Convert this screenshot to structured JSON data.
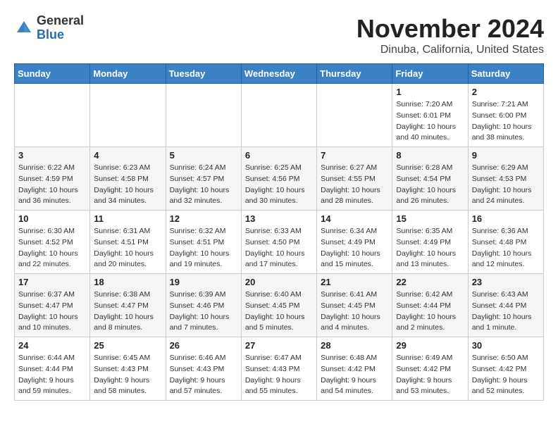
{
  "logo": {
    "general": "General",
    "blue": "Blue"
  },
  "header": {
    "month_year": "November 2024",
    "location": "Dinuba, California, United States"
  },
  "weekdays": [
    "Sunday",
    "Monday",
    "Tuesday",
    "Wednesday",
    "Thursday",
    "Friday",
    "Saturday"
  ],
  "weeks": [
    [
      {
        "day": "",
        "info": ""
      },
      {
        "day": "",
        "info": ""
      },
      {
        "day": "",
        "info": ""
      },
      {
        "day": "",
        "info": ""
      },
      {
        "day": "",
        "info": ""
      },
      {
        "day": "1",
        "info": "Sunrise: 7:20 AM\nSunset: 6:01 PM\nDaylight: 10 hours\nand 40 minutes."
      },
      {
        "day": "2",
        "info": "Sunrise: 7:21 AM\nSunset: 6:00 PM\nDaylight: 10 hours\nand 38 minutes."
      }
    ],
    [
      {
        "day": "3",
        "info": "Sunrise: 6:22 AM\nSunset: 4:59 PM\nDaylight: 10 hours\nand 36 minutes."
      },
      {
        "day": "4",
        "info": "Sunrise: 6:23 AM\nSunset: 4:58 PM\nDaylight: 10 hours\nand 34 minutes."
      },
      {
        "day": "5",
        "info": "Sunrise: 6:24 AM\nSunset: 4:57 PM\nDaylight: 10 hours\nand 32 minutes."
      },
      {
        "day": "6",
        "info": "Sunrise: 6:25 AM\nSunset: 4:56 PM\nDaylight: 10 hours\nand 30 minutes."
      },
      {
        "day": "7",
        "info": "Sunrise: 6:27 AM\nSunset: 4:55 PM\nDaylight: 10 hours\nand 28 minutes."
      },
      {
        "day": "8",
        "info": "Sunrise: 6:28 AM\nSunset: 4:54 PM\nDaylight: 10 hours\nand 26 minutes."
      },
      {
        "day": "9",
        "info": "Sunrise: 6:29 AM\nSunset: 4:53 PM\nDaylight: 10 hours\nand 24 minutes."
      }
    ],
    [
      {
        "day": "10",
        "info": "Sunrise: 6:30 AM\nSunset: 4:52 PM\nDaylight: 10 hours\nand 22 minutes."
      },
      {
        "day": "11",
        "info": "Sunrise: 6:31 AM\nSunset: 4:51 PM\nDaylight: 10 hours\nand 20 minutes."
      },
      {
        "day": "12",
        "info": "Sunrise: 6:32 AM\nSunset: 4:51 PM\nDaylight: 10 hours\nand 19 minutes."
      },
      {
        "day": "13",
        "info": "Sunrise: 6:33 AM\nSunset: 4:50 PM\nDaylight: 10 hours\nand 17 minutes."
      },
      {
        "day": "14",
        "info": "Sunrise: 6:34 AM\nSunset: 4:49 PM\nDaylight: 10 hours\nand 15 minutes."
      },
      {
        "day": "15",
        "info": "Sunrise: 6:35 AM\nSunset: 4:49 PM\nDaylight: 10 hours\nand 13 minutes."
      },
      {
        "day": "16",
        "info": "Sunrise: 6:36 AM\nSunset: 4:48 PM\nDaylight: 10 hours\nand 12 minutes."
      }
    ],
    [
      {
        "day": "17",
        "info": "Sunrise: 6:37 AM\nSunset: 4:47 PM\nDaylight: 10 hours\nand 10 minutes."
      },
      {
        "day": "18",
        "info": "Sunrise: 6:38 AM\nSunset: 4:47 PM\nDaylight: 10 hours\nand 8 minutes."
      },
      {
        "day": "19",
        "info": "Sunrise: 6:39 AM\nSunset: 4:46 PM\nDaylight: 10 hours\nand 7 minutes."
      },
      {
        "day": "20",
        "info": "Sunrise: 6:40 AM\nSunset: 4:45 PM\nDaylight: 10 hours\nand 5 minutes."
      },
      {
        "day": "21",
        "info": "Sunrise: 6:41 AM\nSunset: 4:45 PM\nDaylight: 10 hours\nand 4 minutes."
      },
      {
        "day": "22",
        "info": "Sunrise: 6:42 AM\nSunset: 4:44 PM\nDaylight: 10 hours\nand 2 minutes."
      },
      {
        "day": "23",
        "info": "Sunrise: 6:43 AM\nSunset: 4:44 PM\nDaylight: 10 hours\nand 1 minute."
      }
    ],
    [
      {
        "day": "24",
        "info": "Sunrise: 6:44 AM\nSunset: 4:44 PM\nDaylight: 9 hours\nand 59 minutes."
      },
      {
        "day": "25",
        "info": "Sunrise: 6:45 AM\nSunset: 4:43 PM\nDaylight: 9 hours\nand 58 minutes."
      },
      {
        "day": "26",
        "info": "Sunrise: 6:46 AM\nSunset: 4:43 PM\nDaylight: 9 hours\nand 57 minutes."
      },
      {
        "day": "27",
        "info": "Sunrise: 6:47 AM\nSunset: 4:43 PM\nDaylight: 9 hours\nand 55 minutes."
      },
      {
        "day": "28",
        "info": "Sunrise: 6:48 AM\nSunset: 4:42 PM\nDaylight: 9 hours\nand 54 minutes."
      },
      {
        "day": "29",
        "info": "Sunrise: 6:49 AM\nSunset: 4:42 PM\nDaylight: 9 hours\nand 53 minutes."
      },
      {
        "day": "30",
        "info": "Sunrise: 6:50 AM\nSunset: 4:42 PM\nDaylight: 9 hours\nand 52 minutes."
      }
    ]
  ]
}
